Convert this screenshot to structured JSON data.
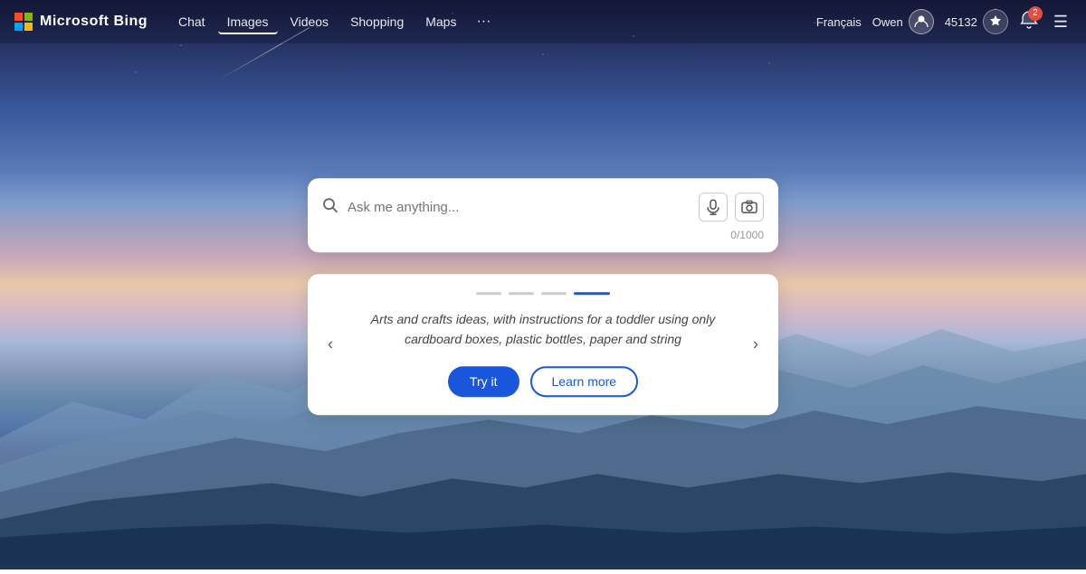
{
  "brand": {
    "logo_text": "Microsoft Bing"
  },
  "navbar": {
    "links": [
      {
        "label": "Chat",
        "active": false
      },
      {
        "label": "Images",
        "active": true
      },
      {
        "label": "Videos",
        "active": false
      },
      {
        "label": "Shopping",
        "active": false
      },
      {
        "label": "Maps",
        "active": false
      }
    ],
    "more_label": "···",
    "language": "Français",
    "user_name": "Owen",
    "score": "45132",
    "notif_count": "2",
    "hamburger": "☰"
  },
  "search": {
    "placeholder": "Ask me anything...",
    "char_count": "0/1000",
    "mic_label": "microphone",
    "visual_search_label": "visual search"
  },
  "suggestion": {
    "dots": [
      {
        "active": false
      },
      {
        "active": false
      },
      {
        "active": false
      },
      {
        "active": true
      }
    ],
    "text": "Arts and crafts ideas, with instructions for a toddler using only cardboard boxes, plastic bottles, paper and string",
    "try_it_label": "Try it",
    "learn_more_label": "Learn more",
    "prev_label": "‹",
    "next_label": "›"
  }
}
